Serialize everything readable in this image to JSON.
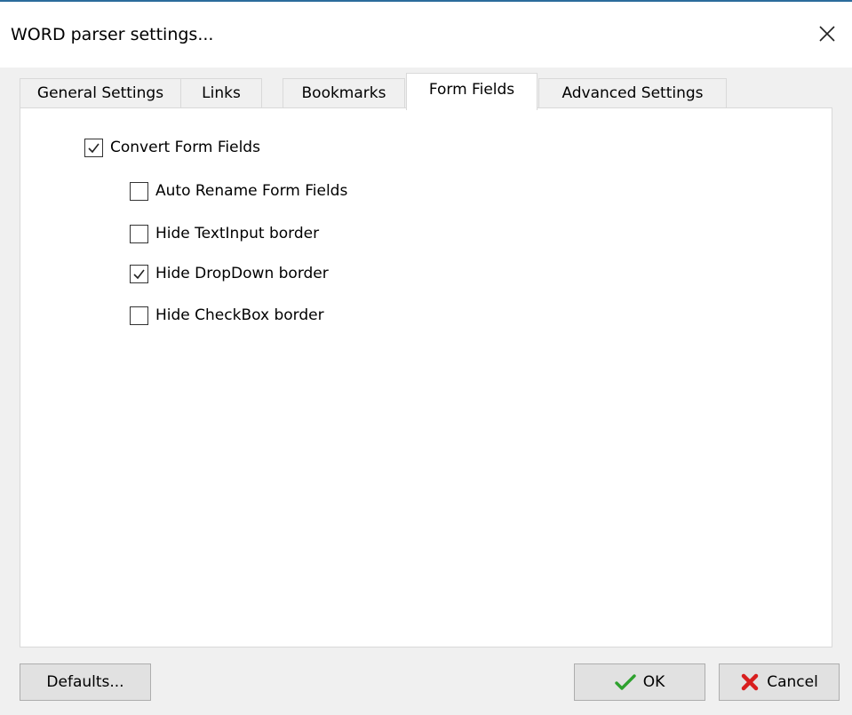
{
  "window": {
    "title": "WORD parser settings..."
  },
  "tabs": [
    {
      "label": "General Settings",
      "active": false
    },
    {
      "label": "Links",
      "active": false
    },
    {
      "label": "Bookmarks",
      "active": false
    },
    {
      "label": "Form Fields",
      "active": true
    },
    {
      "label": "Advanced Settings",
      "active": false
    }
  ],
  "form_fields": {
    "convert": {
      "label": "Convert Form Fields",
      "checked": true
    },
    "options": [
      {
        "label": "Auto Rename Form Fields",
        "checked": false
      },
      {
        "label": "Hide TextInput border",
        "checked": false
      },
      {
        "label": "Hide DropDown border",
        "checked": true
      },
      {
        "label": "Hide CheckBox border",
        "checked": false
      }
    ]
  },
  "buttons": {
    "defaults": "Defaults...",
    "ok": "OK",
    "cancel": "Cancel"
  },
  "icons": {
    "close": "close-icon",
    "ok": "checkmark-icon",
    "cancel": "red-x-icon"
  },
  "colors": {
    "ok_check": "#2ea12e",
    "cancel_x": "#d81e1e"
  }
}
